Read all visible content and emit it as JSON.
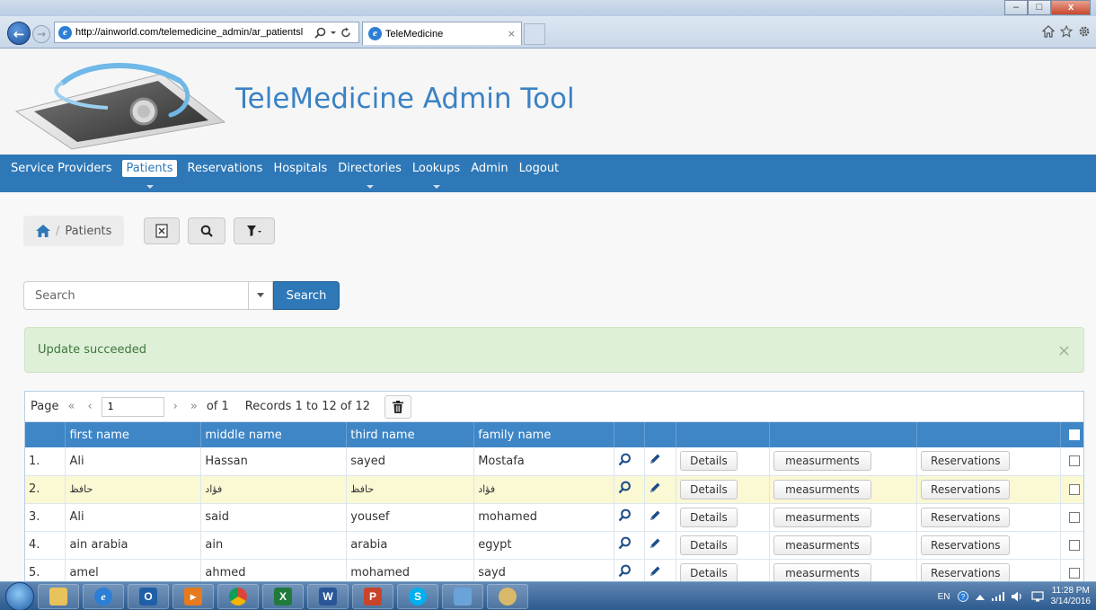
{
  "browser": {
    "url": "http://ainworld.com/telemedicine_admin/ar_patientsl",
    "tab_title": "TeleMedicine",
    "tab_close": "×",
    "back": "←",
    "forward": "→"
  },
  "window_controls": {
    "minimize": "–",
    "maximize": "□",
    "close": "x"
  },
  "header": {
    "title": "TeleMedicine Admin Tool"
  },
  "nav": {
    "items": [
      {
        "label": "Service Providers",
        "caret": false
      },
      {
        "label": "Patients",
        "caret": true,
        "active": true
      },
      {
        "label": "Reservations",
        "caret": false
      },
      {
        "label": "Hospitals",
        "caret": false
      },
      {
        "label": "Directories",
        "caret": true
      },
      {
        "label": "Lookups",
        "caret": true
      },
      {
        "label": "Admin",
        "caret": false
      },
      {
        "label": "Logout",
        "caret": false
      }
    ]
  },
  "breadcrumb": {
    "separator": "/",
    "current": "Patients"
  },
  "search": {
    "placeholder": "Search",
    "button": "Search"
  },
  "alert": {
    "message": "Update succeeded",
    "close": "×"
  },
  "pager": {
    "label": "Page",
    "first": "«",
    "prev": "‹",
    "current": "1",
    "next": "›",
    "last": "»",
    "of": "of 1",
    "records": "Records 1 to 12 of 12"
  },
  "table": {
    "columns": [
      "",
      "first name",
      "middle name",
      "third name",
      "family name"
    ],
    "details_label": "Details",
    "measurments_label": "measurments",
    "reservations_label": "Reservations",
    "rows": [
      {
        "num": "1.",
        "first": "Ali",
        "middle": "Hassan",
        "third": "sayed",
        "family": "Mostafa"
      },
      {
        "num": "2.",
        "first": "حافظ",
        "middle": "فؤاد",
        "third": "حافظ",
        "family": "فؤاد"
      },
      {
        "num": "3.",
        "first": "Ali",
        "middle": "said",
        "third": "yousef",
        "family": "mohamed"
      },
      {
        "num": "4.",
        "first": "ain arabia",
        "middle": "ain",
        "third": "arabia",
        "family": "egypt"
      },
      {
        "num": "5.",
        "first": "amel",
        "middle": "ahmed",
        "third": "mohamed",
        "family": "sayd"
      }
    ]
  },
  "taskbar": {
    "tray_lang": "EN",
    "time": "11:28 PM",
    "date": "3/14/2016"
  },
  "colors": {
    "nav_bg": "#2e78b7",
    "title_color": "#3a82c4",
    "alert_bg": "#dff0d8",
    "alt_row": "#fbf8d4",
    "table_header": "#3e86c6"
  }
}
